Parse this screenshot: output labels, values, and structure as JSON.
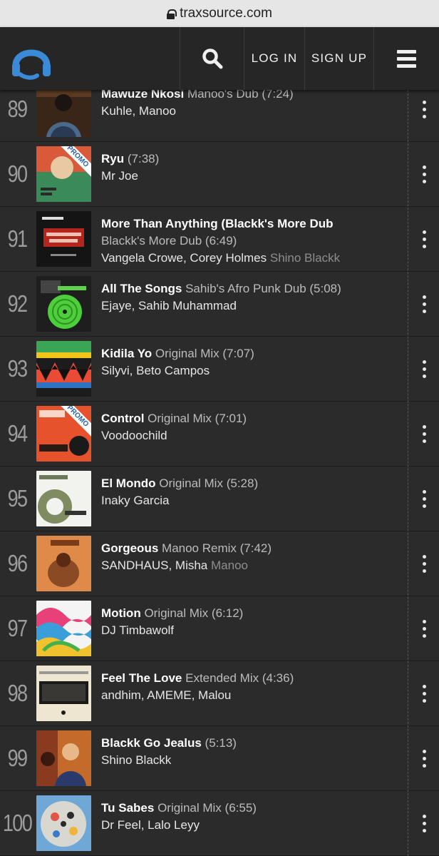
{
  "browser": {
    "url": "traxsource.com"
  },
  "nav": {
    "login": "LOG IN",
    "signup": "SIGN UP"
  },
  "tracks": [
    {
      "rank": "89",
      "title": "Mawuze Nkosi",
      "mix": "Manoo's Dub",
      "length": "(7:24)",
      "artists": "Kuhle, Manoo",
      "remixers": "",
      "promo": false
    },
    {
      "rank": "90",
      "title": "Ryu",
      "mix": "",
      "length": "(7:38)",
      "artists": "Mr Joe",
      "remixers": "",
      "promo": true
    },
    {
      "rank": "91",
      "title": "More Than Anything (Blackk's More Dub",
      "mix": "Blackk's More Dub",
      "length": "(6:49)",
      "artists": "Vangela Crowe, Corey Holmes",
      "remixers": "Shino Blackk",
      "promo": false
    },
    {
      "rank": "92",
      "title": "All The Songs",
      "mix": "Sahib's Afro Punk Dub",
      "length": "(5:08)",
      "artists": "Ejaye, Sahib Muhammad",
      "remixers": "",
      "promo": false
    },
    {
      "rank": "93",
      "title": "Kidila Yo",
      "mix": "Original Mix",
      "length": "(7:07)",
      "artists": "Silyvi, Beto Campos",
      "remixers": "",
      "promo": false
    },
    {
      "rank": "94",
      "title": "Control",
      "mix": "Original Mix",
      "length": "(7:01)",
      "artists": "Voodoochild",
      "remixers": "",
      "promo": true
    },
    {
      "rank": "95",
      "title": "El Mondo",
      "mix": "Original Mix",
      "length": "(5:28)",
      "artists": "Inaky Garcia",
      "remixers": "",
      "promo": false
    },
    {
      "rank": "96",
      "title": "Gorgeous",
      "mix": "Manoo Remix",
      "length": "(7:42)",
      "artists": "SANDHAUS, Misha",
      "remixers": "Manoo",
      "promo": false
    },
    {
      "rank": "97",
      "title": "Motion",
      "mix": "Original Mix",
      "length": "(6:12)",
      "artists": "DJ Timbawolf",
      "remixers": "",
      "promo": false
    },
    {
      "rank": "98",
      "title": "Feel The Love",
      "mix": "Extended Mix",
      "length": "(4:36)",
      "artists": "andhim, AMEME, Malou",
      "remixers": "",
      "promo": false
    },
    {
      "rank": "99",
      "title": "Blackk Go Jealus",
      "mix": "",
      "length": "(5:13)",
      "artists": "Shino Blackk",
      "remixers": "",
      "promo": false
    },
    {
      "rank": "100",
      "title": "Tu Sabes",
      "mix": "Original Mix",
      "length": "(6:55)",
      "artists": "Dr Feel, Lalo Leyy",
      "remixers": "",
      "promo": false
    }
  ],
  "labels": {
    "promo": "PROMO"
  },
  "colors": {
    "accent": "#3b8ad8",
    "promo_text": "#2a62a7",
    "bg": "#2b2b2b"
  },
  "icons": {
    "logo": "headphones-icon",
    "search": "search-icon",
    "menu": "hamburger-icon",
    "more": "kebab-menu-icon",
    "lock": "lock-icon"
  }
}
